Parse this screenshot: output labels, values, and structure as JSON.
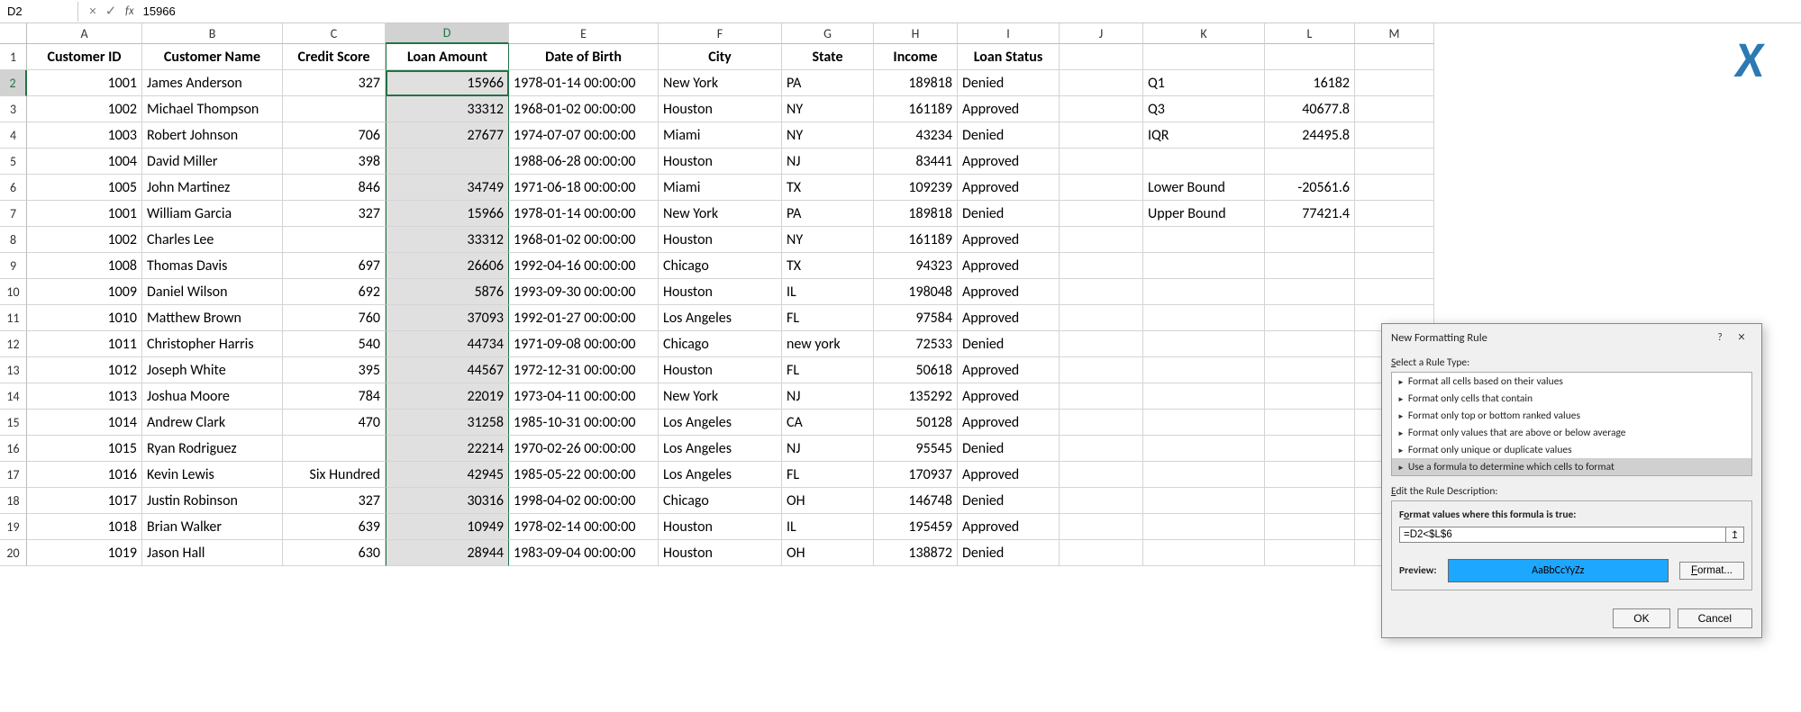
{
  "formula_bar": {
    "cell_ref": "D2",
    "cancel": "×",
    "confirm": "✓",
    "fx": "fx",
    "value": "15966"
  },
  "columns": [
    "A",
    "B",
    "C",
    "D",
    "E",
    "F",
    "G",
    "H",
    "I",
    "J",
    "K",
    "L",
    "M"
  ],
  "col_widths": [
    "w-A",
    "w-B",
    "w-C",
    "w-D",
    "w-E",
    "w-F",
    "w-G",
    "w-H",
    "w-I",
    "w-J",
    "w-K",
    "w-L",
    "w-M"
  ],
  "selected_col": "D",
  "selected_row": 2,
  "headers": [
    "Customer ID",
    "Customer Name",
    "Credit Score",
    "Loan Amount",
    "Date of Birth",
    "City",
    "State",
    "Income",
    "Loan Status"
  ],
  "rows": [
    {
      "n": 1,
      "cells": [
        "Customer ID",
        "Customer Name",
        "Credit Score",
        "Loan Amount",
        "Date of Birth",
        "City",
        "State",
        "Income",
        "Loan Status",
        "",
        "",
        "",
        ""
      ],
      "header": true
    },
    {
      "n": 2,
      "cells": [
        "1001",
        "James Anderson",
        "327",
        "15966",
        "1978-01-14 00:00:00",
        "New York",
        "PA",
        "189818",
        "Denied",
        "",
        "Q1",
        "16182",
        ""
      ]
    },
    {
      "n": 3,
      "cells": [
        "1002",
        "Michael Thompson",
        "",
        "33312",
        "1968-01-02 00:00:00",
        "Houston",
        "NY",
        "161189",
        "Approved",
        "",
        "Q3",
        "40677.8",
        ""
      ]
    },
    {
      "n": 4,
      "cells": [
        "1003",
        "Robert Johnson",
        "706",
        "27677",
        "1974-07-07 00:00:00",
        "Miami",
        "NY",
        "43234",
        "Denied",
        "",
        "IQR",
        "24495.8",
        ""
      ]
    },
    {
      "n": 5,
      "cells": [
        "1004",
        "David Miller",
        "398",
        "",
        "1988-06-28 00:00:00",
        "Houston",
        "NJ",
        "83441",
        "Approved",
        "",
        "",
        "",
        ""
      ]
    },
    {
      "n": 6,
      "cells": [
        "1005",
        "John Martinez",
        "846",
        "34749",
        "1971-06-18 00:00:00",
        "Miami",
        "TX",
        "109239",
        "Approved",
        "",
        "Lower Bound",
        "-20561.6",
        ""
      ]
    },
    {
      "n": 7,
      "cells": [
        "1001",
        "William Garcia",
        "327",
        "15966",
        "1978-01-14 00:00:00",
        "New York",
        "PA",
        "189818",
        "Denied",
        "",
        "Upper Bound",
        "77421.4",
        ""
      ]
    },
    {
      "n": 8,
      "cells": [
        "1002",
        "Charles Lee",
        "",
        "33312",
        "1968-01-02 00:00:00",
        "Houston",
        "NY",
        "161189",
        "Approved",
        "",
        "",
        "",
        ""
      ]
    },
    {
      "n": 9,
      "cells": [
        "1008",
        "Thomas Davis",
        "697",
        "26606",
        "1992-04-16 00:00:00",
        "Chicago",
        "TX",
        "94323",
        "Approved",
        "",
        "",
        "",
        ""
      ]
    },
    {
      "n": 10,
      "cells": [
        "1009",
        "Daniel Wilson",
        "692",
        "5876",
        "1993-09-30 00:00:00",
        "Houston",
        "IL",
        "198048",
        "Approved",
        "",
        "",
        "",
        ""
      ]
    },
    {
      "n": 11,
      "cells": [
        "1010",
        "Matthew Brown",
        "760",
        "37093",
        "1992-01-27 00:00:00",
        "Los Angeles",
        "FL",
        "97584",
        "Approved",
        "",
        "",
        "",
        ""
      ]
    },
    {
      "n": 12,
      "cells": [
        "1011",
        "Christopher Harris",
        "540",
        "44734",
        "1971-09-08 00:00:00",
        "Chicago",
        "new york",
        "72533",
        "Denied",
        "",
        "",
        "",
        ""
      ]
    },
    {
      "n": 13,
      "cells": [
        "1012",
        "Joseph White",
        "395",
        "44567",
        "1972-12-31 00:00:00",
        "Houston",
        "FL",
        "50618",
        "Approved",
        "",
        "",
        "",
        ""
      ]
    },
    {
      "n": 14,
      "cells": [
        "1013",
        "Joshua Moore",
        "784",
        "22019",
        "1973-04-11 00:00:00",
        "New York",
        "NJ",
        "135292",
        "Approved",
        "",
        "",
        "",
        ""
      ]
    },
    {
      "n": 15,
      "cells": [
        "1014",
        "Andrew Clark",
        "470",
        "31258",
        "1985-10-31 00:00:00",
        "Los Angeles",
        "CA",
        "50128",
        "Approved",
        "",
        "",
        "",
        ""
      ]
    },
    {
      "n": 16,
      "cells": [
        "1015",
        "Ryan Rodriguez",
        "",
        "22214",
        "1970-02-26 00:00:00",
        "Los Angeles",
        "NJ",
        "95545",
        "Denied",
        "",
        "",
        "",
        ""
      ]
    },
    {
      "n": 17,
      "cells": [
        "1016",
        "Kevin Lewis",
        "Six Hundred",
        "42945",
        "1985-05-22 00:00:00",
        "Los Angeles",
        "FL",
        "170937",
        "Approved",
        "",
        "",
        "",
        ""
      ]
    },
    {
      "n": 18,
      "cells": [
        "1017",
        "Justin Robinson",
        "327",
        "30316",
        "1998-04-02 00:00:00",
        "Chicago",
        "OH",
        "146748",
        "Denied",
        "",
        "",
        "",
        ""
      ]
    },
    {
      "n": 19,
      "cells": [
        "1018",
        "Brian Walker",
        "639",
        "10949",
        "1978-02-14 00:00:00",
        "Houston",
        "IL",
        "195459",
        "Approved",
        "",
        "",
        "",
        ""
      ]
    },
    {
      "n": 20,
      "cells": [
        "1019",
        "Jason Hall",
        "630",
        "28944",
        "1983-09-04 00:00:00",
        "Houston",
        "OH",
        "138872",
        "Denied",
        "",
        "",
        "",
        ""
      ]
    }
  ],
  "align": {
    "right_cols": [
      0,
      2,
      3,
      7,
      11
    ],
    "center_first_row": true
  },
  "dialog": {
    "title": "New Formatting Rule",
    "help": "?",
    "close": "×",
    "select_label": "Select a Rule Type:",
    "rules": [
      "Format all cells based on their values",
      "Format only cells that contain",
      "Format only top or bottom ranked values",
      "Format only values that are above or below average",
      "Format only unique or duplicate values",
      "Use a formula to determine which cells to format"
    ],
    "selected_rule": 5,
    "edit_label": "Edit the Rule Description:",
    "formula_label": "Format values where this formula is true:",
    "formula_value": "=D2<$L$6",
    "picker_icon": "↥",
    "preview_label": "Preview:",
    "preview_text": "AaBbCcYyZz",
    "format_btn": "Format...",
    "ok": "OK",
    "cancel": "Cancel"
  },
  "chart_data": {
    "type": "table",
    "title": "Loan Applicant Data with IQR Outlier Bounds",
    "columns": [
      "Customer ID",
      "Customer Name",
      "Credit Score",
      "Loan Amount",
      "Date of Birth",
      "City",
      "State",
      "Income",
      "Loan Status"
    ],
    "records": [
      [
        1001,
        "James Anderson",
        327,
        15966,
        "1978-01-14",
        "New York",
        "PA",
        189818,
        "Denied"
      ],
      [
        1002,
        "Michael Thompson",
        null,
        33312,
        "1968-01-02",
        "Houston",
        "NY",
        161189,
        "Approved"
      ],
      [
        1003,
        "Robert Johnson",
        706,
        27677,
        "1974-07-07",
        "Miami",
        "NY",
        43234,
        "Denied"
      ],
      [
        1004,
        "David Miller",
        398,
        null,
        "1988-06-28",
        "Houston",
        "NJ",
        83441,
        "Approved"
      ],
      [
        1005,
        "John Martinez",
        846,
        34749,
        "1971-06-18",
        "Miami",
        "TX",
        109239,
        "Approved"
      ],
      [
        1001,
        "William Garcia",
        327,
        15966,
        "1978-01-14",
        "New York",
        "PA",
        189818,
        "Denied"
      ],
      [
        1002,
        "Charles Lee",
        null,
        33312,
        "1968-01-02",
        "Houston",
        "NY",
        161189,
        "Approved"
      ],
      [
        1008,
        "Thomas Davis",
        697,
        26606,
        "1992-04-16",
        "Chicago",
        "TX",
        94323,
        "Approved"
      ],
      [
        1009,
        "Daniel Wilson",
        692,
        5876,
        "1993-09-30",
        "Houston",
        "IL",
        198048,
        "Approved"
      ],
      [
        1010,
        "Matthew Brown",
        760,
        37093,
        "1992-01-27",
        "Los Angeles",
        "FL",
        97584,
        "Approved"
      ],
      [
        1011,
        "Christopher Harris",
        540,
        44734,
        "1971-09-08",
        "Chicago",
        "new york",
        72533,
        "Denied"
      ],
      [
        1012,
        "Joseph White",
        395,
        44567,
        "1972-12-31",
        "Houston",
        "FL",
        50618,
        "Approved"
      ],
      [
        1013,
        "Joshua Moore",
        784,
        22019,
        "1973-04-11",
        "New York",
        "NJ",
        135292,
        "Approved"
      ],
      [
        1014,
        "Andrew Clark",
        470,
        31258,
        "1985-10-31",
        "Los Angeles",
        "CA",
        50128,
        "Approved"
      ],
      [
        1015,
        "Ryan Rodriguez",
        null,
        22214,
        "1970-02-26",
        "Los Angeles",
        "NJ",
        95545,
        "Denied"
      ],
      [
        1016,
        "Kevin Lewis",
        "Six Hundred",
        42945,
        "1985-05-22",
        "Los Angeles",
        "FL",
        170937,
        "Approved"
      ],
      [
        1017,
        "Justin Robinson",
        327,
        30316,
        "1998-04-02",
        "Chicago",
        "OH",
        146748,
        "Denied"
      ],
      [
        1018,
        "Brian Walker",
        639,
        10949,
        "1978-02-14",
        "Houston",
        "IL",
        195459,
        "Approved"
      ],
      [
        1019,
        "Jason Hall",
        630,
        28944,
        "1983-09-04",
        "Houston",
        "OH",
        138872,
        "Denied"
      ]
    ],
    "stats": {
      "Q1": 16182,
      "Q3": 40677.8,
      "IQR": 24495.8,
      "Lower Bound": -20561.6,
      "Upper Bound": 77421.4
    }
  }
}
